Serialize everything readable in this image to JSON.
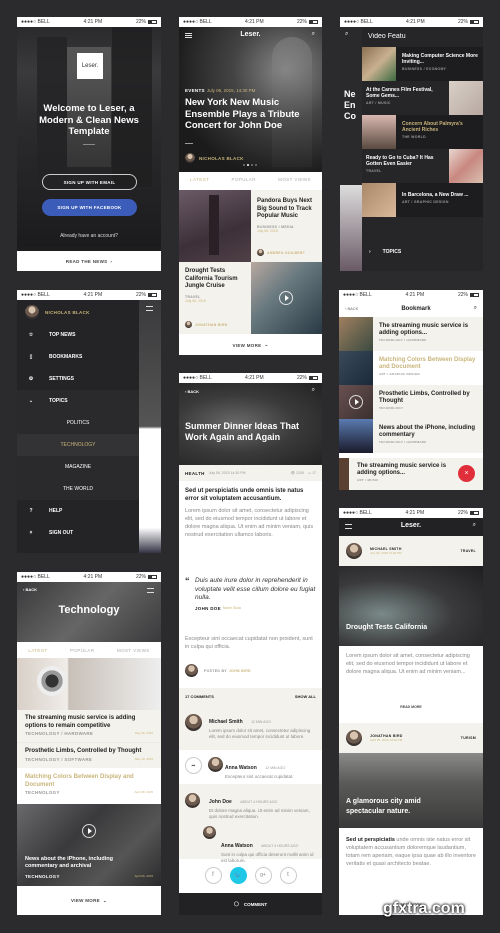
{
  "status_bar": {
    "carrier": "●●●●○ BELL",
    "time": "4:21 PM",
    "battery": "22%"
  },
  "brand": "Leser.",
  "welcome": {
    "logo": "Leser.",
    "title": "Welcome to Leser, a Modern & Clean News Template",
    "email_button": "SIGN UP WITH EMAIL",
    "facebook_button": "SIGN UP WITH FACEBOOK",
    "account_text": "Already have an account?",
    "read_news": "READ THE NEWS",
    "facebook_color": "#3b5cb8"
  },
  "home": {
    "hero": {
      "category": "EVENTS",
      "date": "July 06, 2015, 14:30 PM",
      "title": "New York New Music Ensemble Plays a Tribute Concert for John Doe",
      "author": "NICHOLAS BLACK"
    },
    "tabs": [
      "LATEST",
      "POPULAR",
      "MOST VIEWS"
    ],
    "cards": [
      {
        "title": "Pandora Buys Next Big Sound to Track Popular Music",
        "category": "BUSINESS / MEDIA",
        "date": "July 06, 2015",
        "author": "ANDREA GUILBERT"
      },
      {
        "title": "Drought Tests California Tourism Jungle Cruise",
        "category": "TRAVEL",
        "date": "July 06, 2015",
        "author": "JONATHAN BIRD"
      }
    ],
    "view_more": "VIEW MORE"
  },
  "search": {
    "query": "Video Featu",
    "results": [
      {
        "title": "Making Computer Science More Inviting...",
        "category": "BUSINESS / ECONOMY",
        "highlight": false
      },
      {
        "title": "At the Cannes Film Festival, Some Gems...",
        "category": "ART / MUSIC",
        "highlight": false
      },
      {
        "title": "Concern About Palmyra's Ancient Riches",
        "category": "THE WORLD",
        "highlight": true
      },
      {
        "title": "Ready to Go to Cuba? It Has Gotten Even Easier",
        "category": "TRAVEL",
        "highlight": false
      },
      {
        "title": "In Barcelona, a New Draw ...",
        "category": "ART / GRAPHIC DESIGN",
        "highlight": false
      }
    ],
    "topics": "TOPICS"
  },
  "menu": {
    "user": "NICHOLAS BLACK",
    "items": [
      {
        "label": "TOP NEWS",
        "icon": "star"
      },
      {
        "label": "BOOKMARKS",
        "icon": "bookmark"
      },
      {
        "label": "SETTINGS",
        "icon": "gear"
      },
      {
        "label": "TOPICS",
        "icon": "chevron-down"
      }
    ],
    "subitems": [
      "POLITICS",
      "TECHNOLOGY",
      "MAGAZINE",
      "THE WORLD"
    ],
    "active_sub": "TECHNOLOGY",
    "footer_items": [
      {
        "label": "HELP",
        "icon": "help"
      },
      {
        "label": "SIGN OUT",
        "icon": "close"
      }
    ]
  },
  "article": {
    "back": "BACK",
    "title": "Summer Dinner Ideas That Work Again and Again",
    "category": "HEALTH",
    "date": "July 06, 2015 14:30 PM",
    "views": "1205",
    "comments_count_icon": "17",
    "lead": "Sed ut perspiciatis unde omnis iste natus error sit voluptatem accusantium.",
    "body1": "Lorem ipsum dolor sit amet, consectetur adipiscing elit, sed do eiusmod tempor incididunt ut labore et dolore magna aliqua. Ut enim ad minim veniam, quis nostrud exercitation ullamco laboris.",
    "quote": "Duis aute irure dolor in reprehenderit in voluptate velit esse cillum dolore eu fugiat nulla.",
    "quote_author": "JOHN DOE",
    "quote_source": "Name Book",
    "body2": "Excepteur sint occaecat cupidatat non proident, sunt in culpa qui officia.",
    "posted_by_label": "POSTED BY",
    "posted_by": "JOHN BIRD",
    "comments_label": "17 COMMENTS",
    "show_all": "SHOW ALL",
    "comments": [
      {
        "name": "Michael Smith",
        "time": "12 MIN AGO",
        "text": "Lorem ipsum dolor sit amet, consectetur adipiscing elit, sed do eiusmod tempor incididunt ut labore.",
        "reply": false
      },
      {
        "name": "Anna Watson",
        "time": "12 MIN AGO",
        "text": "Excepteur sint occaecat cupidatat.",
        "reply": true
      },
      {
        "name": "John Doe",
        "time": "ABOUT 4 HOURS AGO",
        "text": "Et dolore magna aliqua. Ut enim ad minim veniam, quis nostrud exercitation.",
        "reply": false
      },
      {
        "name": "Anna Watson",
        "time": "ABOUT 4 HOURS AGO",
        "text": "Sunt in culpa qui officia deserunt mollit anim id est laborum.",
        "reply": true
      }
    ],
    "share": [
      "f",
      "twitter",
      "g+",
      "t"
    ],
    "twitter_color": "#1ec8e6",
    "comment_button": "COMMENT"
  },
  "bookmark": {
    "back": "BACK",
    "title": "Bookmark",
    "items": [
      {
        "title": "The streaming music service is adding options...",
        "category": "TECHNOLOGY / HARDWARE",
        "highlight": false
      },
      {
        "title": "Matching Colors Between Display and Document",
        "category": "ART / GRAPHIC DESIGN",
        "highlight": true
      },
      {
        "title": "Prosthetic Limbs, Controlled by Thought",
        "category": "TECHNOLOGY",
        "highlight": false
      },
      {
        "title": "News about the iPhone, including commentary",
        "category": "TECHNOLOGY / HARDWARE",
        "highlight": false
      }
    ],
    "swipe_item": {
      "title": "The streaming music service is adding options...",
      "category": "ART / MUSIC"
    },
    "delete_color": "#e02f3a"
  },
  "technology": {
    "back": "BACK",
    "title": "Technology",
    "tabs": [
      "LATEST",
      "POPULAR",
      "MOST VIEWS"
    ],
    "items": [
      {
        "title": "The streaming music service is adding options to remain competitive",
        "category": "TECHNOLOGY / HARDWARE",
        "date": "May 28, 2015",
        "highlight": false
      },
      {
        "title": "Prosthetic Limbs, Controlled by Thought",
        "category": "TECHNOLOGY / SOFTWARE",
        "date": "May 10, 2015",
        "highlight": false
      },
      {
        "title": "Matching Colors Between Display and Document",
        "category": "TECHNOLOGY",
        "date": "April 28, 2015",
        "highlight": true
      }
    ],
    "feature": {
      "title": "News about the iPhone, including commentary and archival",
      "category": "TECHNOLOGY",
      "date": "April 06, 2015"
    },
    "view_more": "VIEW MORE"
  },
  "feed": {
    "posts": [
      {
        "author": "MICHAEL SMITH",
        "date": "July 06, 2015 14:30 PM",
        "tag": "TRAVEL",
        "title": "Drought Tests California",
        "body": "Lorem ipsum dolor sit amet, consectetur adipiscing elit, sed do eiusmod tempor incididunt ut labore et dolore magna aliqua. Ut enim ad minim veniam...",
        "read_more": "READ MORE"
      },
      {
        "author": "JONATHAN BIRD",
        "date": "April 25, 2015 14:30 PM",
        "tag": "TURISM",
        "title": "A glamorous city amid spectacular nature.",
        "body_bold": "Sed ut perspiciatis",
        "body": " unde omnis iste natus error sit voluptatem accusantium doloremque laudantium, totam rem aperiam, eaque ipsa quae ab illo inventore veritatis et quasi architecto beatae.",
        "read_more": "READ MORE"
      }
    ]
  },
  "watermark": "gfxtra.com"
}
